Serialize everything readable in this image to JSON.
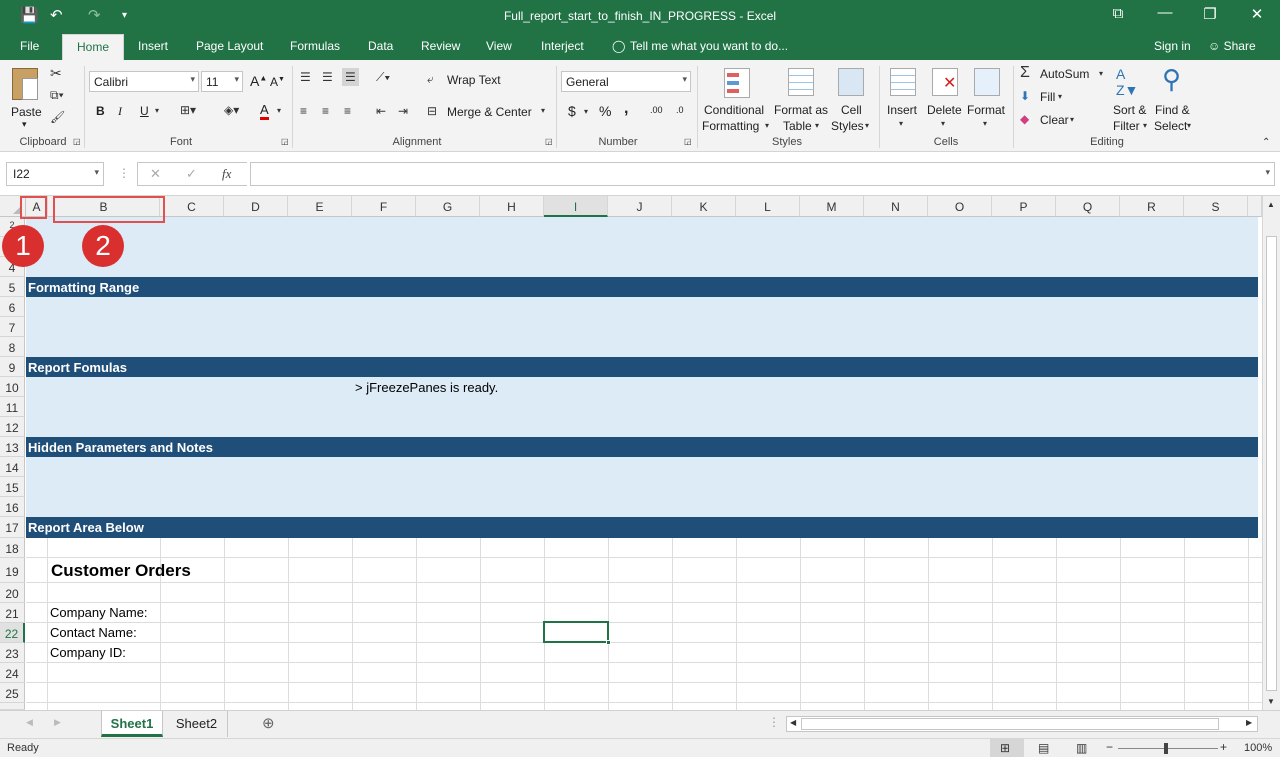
{
  "window": {
    "title": "Full_report_start_to_finish_IN_PROGRESS - Excel",
    "qat_save": "💾",
    "qat_undo": "↶",
    "qat_redo": "↷",
    "qat_more": "▾",
    "ribbon_display": "⧉",
    "minimize": "—",
    "restore": "❐",
    "close": "✕"
  },
  "ribbon_tabs": [
    "File",
    "Home",
    "Insert",
    "Page Layout",
    "Formulas",
    "Data",
    "Review",
    "View",
    "Interject"
  ],
  "tell_me": "Tell me what you want to do...",
  "sign_in": "Sign in",
  "share": "Share",
  "clipboard": {
    "paste": "Paste",
    "group": "Clipboard"
  },
  "font": {
    "name": "Calibri",
    "size": "11",
    "bold": "B",
    "italic": "I",
    "underline": "U",
    "grow": "A",
    "shrink": "A",
    "font_color": "A",
    "group": "Font"
  },
  "alignment": {
    "wrap_text": "Wrap Text",
    "merge_center": "Merge & Center",
    "group": "Alignment"
  },
  "number": {
    "format": "General",
    "currency": "$",
    "percent": "%",
    "comma": ",",
    "inc_decimal": ".00",
    "dec_decimal": ".0",
    "group": "Number"
  },
  "styles": {
    "conditional_1": "Conditional",
    "conditional_2": "Formatting",
    "format_table_1": "Format as",
    "format_table_2": "Table",
    "cell_styles_1": "Cell",
    "cell_styles_2": "Styles",
    "group": "Styles"
  },
  "cells": {
    "insert": "Insert",
    "delete": "Delete",
    "format": "Format",
    "group": "Cells"
  },
  "editing": {
    "autosum": "AutoSum",
    "fill": "Fill",
    "clear": "Clear",
    "sort_1": "Sort &",
    "sort_2": "Filter",
    "find_1": "Find &",
    "find_2": "Select",
    "group": "Editing"
  },
  "formula_bar": {
    "name_box": "I22",
    "cancel": "✕",
    "enter": "✓",
    "fx": "fx",
    "value": ""
  },
  "columns": [
    "A",
    "B",
    "C",
    "D",
    "E",
    "F",
    "G",
    "H",
    "I",
    "J",
    "K",
    "L",
    "M",
    "N",
    "O",
    "P",
    "Q",
    "R",
    "S"
  ],
  "rows": [
    "2",
    "3",
    "4",
    "5",
    "6",
    "7",
    "8",
    "9",
    "10",
    "11",
    "12",
    "13",
    "14",
    "15",
    "16",
    "17",
    "18",
    "19",
    "20",
    "21",
    "22",
    "23",
    "24",
    "25"
  ],
  "sections": {
    "formatting_range": "Formatting Range",
    "report_formulas": "Report Fomulas",
    "hidden_params": "Hidden Parameters and Notes",
    "report_area": "Report Area Below"
  },
  "cells_content": {
    "freeze_msg": "> jFreezePanes is ready.",
    "customer_orders": "Customer Orders",
    "company_name": "Company Name:",
    "contact_name": "Contact Name:",
    "company_id": "Company ID:"
  },
  "annotations": {
    "marker_1": "1",
    "marker_2": "2"
  },
  "sheets": [
    "Sheet1",
    "Sheet2"
  ],
  "active_sheet": "Sheet1",
  "status": {
    "ready": "Ready",
    "zoom": "100%"
  }
}
